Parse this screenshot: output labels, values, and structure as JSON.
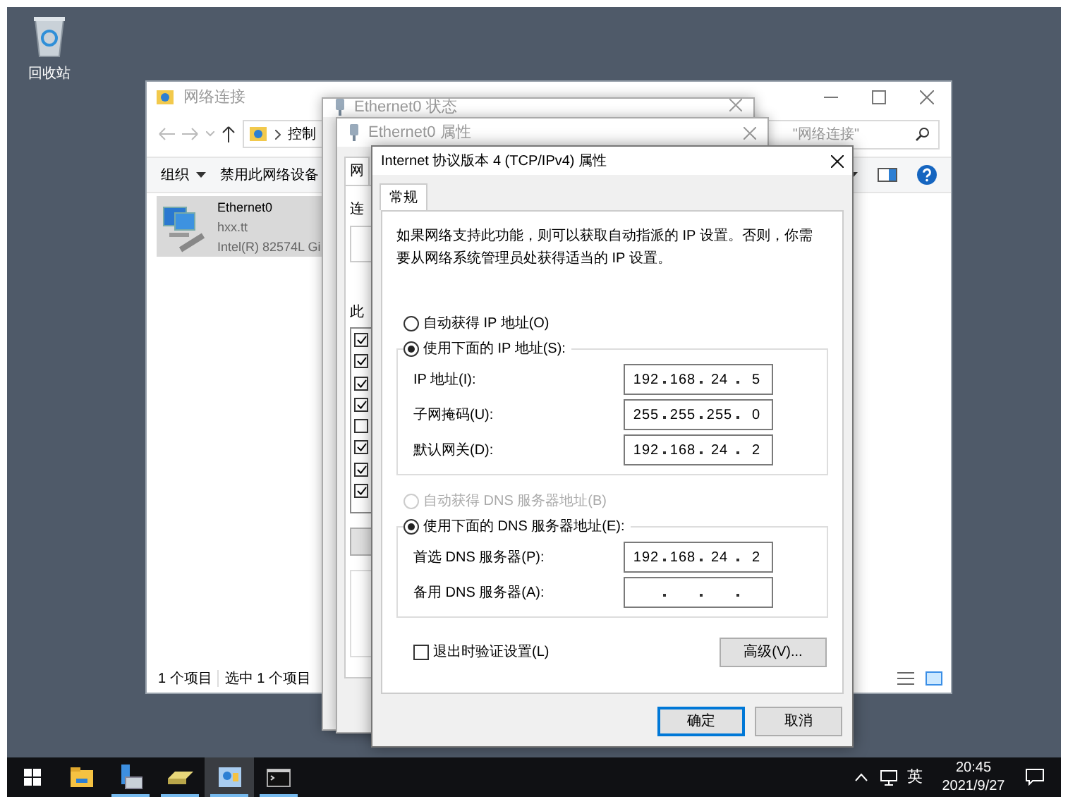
{
  "desktop_icons": [
    {
      "label": "回收站"
    }
  ],
  "explorer": {
    "title": "网络连接",
    "breadcrumb": "控制",
    "search_placeholder": "\"网络连接\"",
    "toolbar": [
      "组织",
      "禁用此网络设备"
    ],
    "adapter": {
      "name": "Ethernet0",
      "network": "hxx.tt",
      "device": "Intel(R) 82574L Gi",
      "selected": true
    },
    "status_bar": [
      "1 个项目",
      "选中 1 个项目"
    ]
  },
  "status_window": {
    "title": "Ethernet0 状态"
  },
  "properties_window": {
    "title": "Ethernet0 属性",
    "tab": "网",
    "connect_label": "连",
    "items_label": "此",
    "components": [
      {
        "checked": true
      },
      {
        "checked": true
      },
      {
        "checked": true
      },
      {
        "checked": true
      },
      {
        "checked": false
      },
      {
        "checked": true
      },
      {
        "checked": true
      },
      {
        "checked": true
      }
    ]
  },
  "ipv4_dialog": {
    "title": "Internet 协议版本 4 (TCP/IPv4) 属性",
    "tabs": [
      {
        "label": "常规",
        "selected": true
      }
    ],
    "description": "如果网络支持此功能，则可以获取自动指派的 IP 设置。否则，你需要从网络系统管理员处获得适当的 IP 设置。",
    "ip_modes": [
      {
        "label": "自动获得 IP 地址(O)",
        "selected": false,
        "disabled": false
      },
      {
        "label": "使用下面的 IP 地址(S):",
        "selected": true,
        "disabled": false
      }
    ],
    "ip_fields": [
      {
        "label": "IP 地址(I):",
        "octets": [
          "192",
          "168",
          "24",
          "5"
        ]
      },
      {
        "label": "子网掩码(U):",
        "octets": [
          "255",
          "255",
          "255",
          "0"
        ]
      },
      {
        "label": "默认网关(D):",
        "octets": [
          "192",
          "168",
          "24",
          "2"
        ]
      }
    ],
    "dns_modes": [
      {
        "label": "自动获得 DNS 服务器地址(B)",
        "selected": false,
        "disabled": true
      },
      {
        "label": "使用下面的 DNS 服务器地址(E):",
        "selected": true,
        "disabled": false
      }
    ],
    "dns_fields": [
      {
        "label": "首选 DNS 服务器(P):",
        "octets": [
          "192",
          "168",
          "24",
          "2"
        ]
      },
      {
        "label": "备用 DNS 服务器(A):"
      }
    ],
    "validate": {
      "label": "退出时验证设置(L)",
      "checked": false
    },
    "advanced_button": "高级(V)...",
    "buttons": [
      {
        "label": "确定",
        "default": true
      },
      {
        "label": "取消",
        "default": false
      }
    ]
  },
  "taskbar": {
    "apps": [
      {
        "kind": "explorer",
        "running": false,
        "selected": false
      },
      {
        "kind": "server",
        "running": true,
        "selected": false
      },
      {
        "kind": "drive",
        "running": true,
        "selected": false
      },
      {
        "kind": "network",
        "running": true,
        "selected": true
      },
      {
        "kind": "terminal",
        "running": true,
        "selected": false
      }
    ],
    "language": "英",
    "time": "20:45",
    "date": "2021/9/27"
  }
}
